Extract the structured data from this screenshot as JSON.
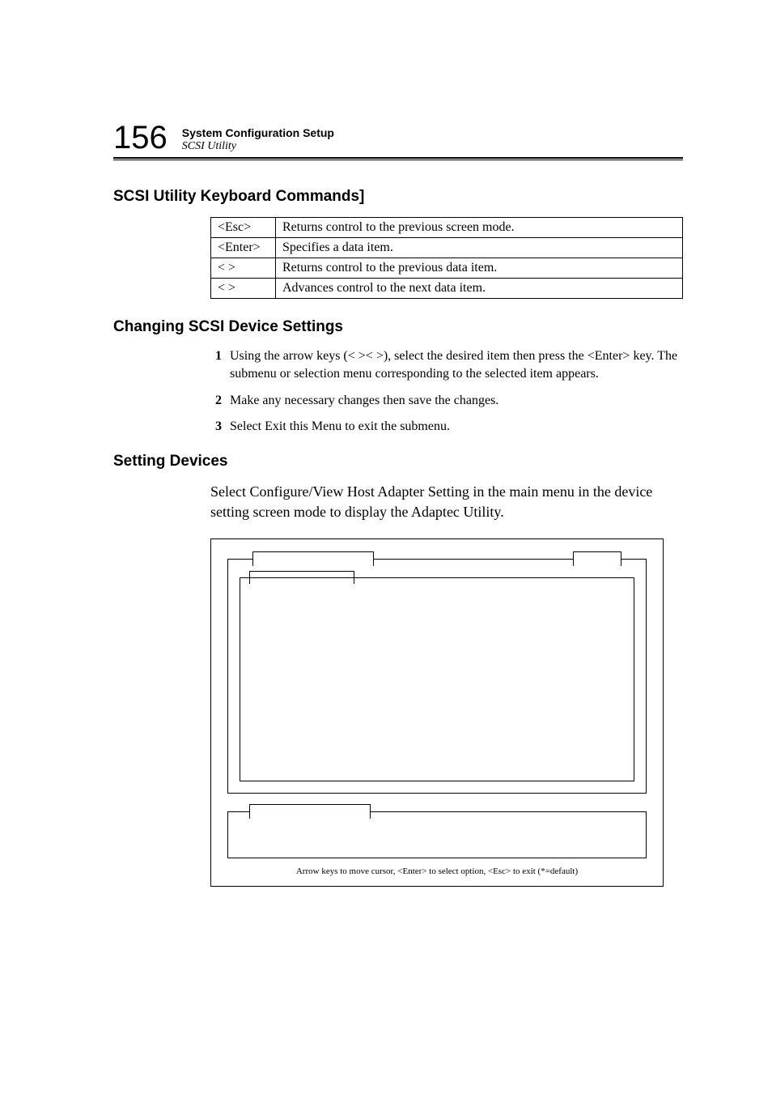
{
  "header": {
    "page_number": "156",
    "title": "System Configuration Setup",
    "subtitle": "SCSI Utility"
  },
  "sections": {
    "s1": {
      "heading": "SCSI Utility Keyboard Commands]",
      "rows": [
        {
          "key": "<Esc>",
          "desc": "Returns control to the previous screen mode."
        },
        {
          "key": "<Enter>",
          "desc": "Specifies a data item."
        },
        {
          "key": "<  >",
          "desc": "Returns control to the previous data item."
        },
        {
          "key": "<  >",
          "desc": "Advances control to the next data item."
        }
      ]
    },
    "s2": {
      "heading": "Changing SCSI Device Settings",
      "steps": [
        "Using the arrow keys (<  ><  >), select the desired item then press the <Enter> key. The submenu or selection menu corresponding to the selected item appears.",
        "Make any necessary changes then save the changes.",
        "Select Exit this Menu to exit the submenu."
      ]
    },
    "s3": {
      "heading": "Setting Devices",
      "paragraph": "Select Configure/View Host Adapter Setting in the main menu in the device setting screen mode to display the Adaptec Utility."
    }
  },
  "diagram": {
    "caption": "Arrow keys to move cursor, <Enter> to select option, <Esc> to exit (*=default)"
  }
}
